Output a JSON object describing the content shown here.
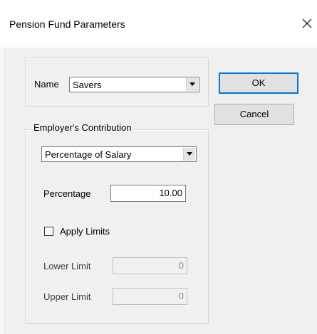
{
  "window": {
    "title": "Pension Fund Parameters",
    "close_glyph": "X"
  },
  "name_group": {
    "label": "Name",
    "value": "Savers"
  },
  "buttons": {
    "ok_label": "OK",
    "cancel_label": "Cancel"
  },
  "contribution_group": {
    "title": "Employer's Contribution",
    "method_value": "Percentage of Salary",
    "percentage_label": "Percentage",
    "percentage_value": "10.00",
    "apply_limits_label": "Apply Limits",
    "apply_limits_checked": false,
    "lower_limit_label": "Lower Limit",
    "lower_limit_value": "0",
    "upper_limit_label": "Upper Limit",
    "upper_limit_value": "0"
  },
  "icons": {
    "close": "close-icon",
    "dropdown": "chevron-down-icon"
  },
  "colors": {
    "titlebar_bg": "#ffffff",
    "dialog_bg": "#f0f0f0",
    "default_button_border": "#0078d7"
  }
}
